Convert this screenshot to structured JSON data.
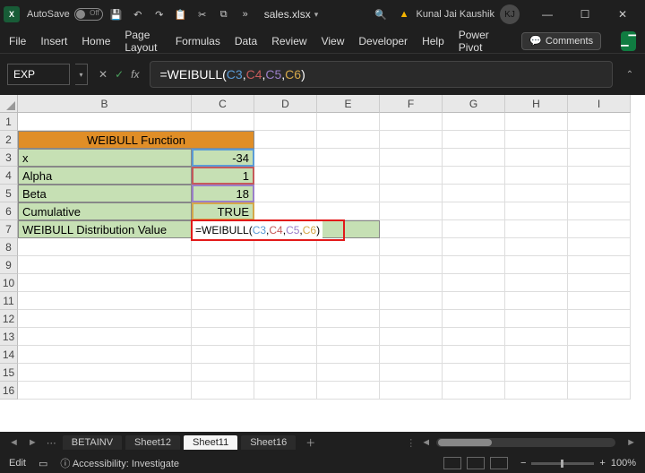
{
  "titlebar": {
    "autosave_label": "AutoSave",
    "autosave_state": "Off",
    "filename": "sales.xlsx",
    "user_name": "Kunal Jai Kaushik",
    "user_initials": "KJ"
  },
  "ribbon": {
    "tabs": [
      "File",
      "Insert",
      "Home",
      "Page Layout",
      "Formulas",
      "Data",
      "Review",
      "View",
      "Developer",
      "Help",
      "Power Pivot"
    ],
    "comments_label": "Comments"
  },
  "formula_bar": {
    "name_box": "EXP",
    "formula_prefix": "=WEIBULL(",
    "ref1": "C3",
    "ref2": "C4",
    "ref3": "C5",
    "ref4": "C6",
    "formula_suffix": ")"
  },
  "columns": [
    "B",
    "C",
    "D",
    "E",
    "F",
    "G",
    "H",
    "I"
  ],
  "rows_visible": 16,
  "sheet": {
    "header_title": "WEIBULL Function",
    "labels": {
      "r3": "x",
      "r4": "Alpha",
      "r5": "Beta",
      "r6": "Cumulative",
      "r7": "WEIBULL Distribution Value"
    },
    "values": {
      "c3": "-34",
      "c4": "1",
      "c5": "18",
      "c6": "TRUE"
    },
    "editing_cell_text": "=WEIBULL(C3,C4,C5,C6)"
  },
  "sheet_tabs": {
    "tabs": [
      "BETAINV",
      "Sheet12",
      "Sheet11",
      "Sheet16"
    ],
    "active_index": 2
  },
  "status": {
    "mode": "Edit",
    "accessibility": "Accessibility: Investigate",
    "zoom": "100%"
  }
}
